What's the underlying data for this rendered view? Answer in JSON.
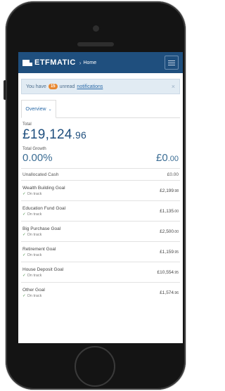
{
  "app": {
    "brand": "ETFMATIC",
    "crumb": "Home",
    "crumb_sep": "›"
  },
  "alert": {
    "prefix": "You have",
    "count": "15",
    "middle": "unread",
    "link": "notifications",
    "close": "×"
  },
  "tabs": {
    "overview": "Overview",
    "chevron": "⌄"
  },
  "summary": {
    "total_label": "Total",
    "total_main": "£19,124",
    "total_pence": ".96",
    "growth_label": "Total Growth",
    "growth_pct": "0.00%",
    "growth_main": "£0",
    "growth_pence": ".00"
  },
  "cash": {
    "label": "Unallocated Cash",
    "value": "£0.00"
  },
  "goals": [
    {
      "name": "Wealth Building Goal",
      "status": "On track",
      "main": "£2,199",
      "pence": ".98"
    },
    {
      "name": "Education Fund Goal",
      "status": "On track",
      "main": "£1,135",
      "pence": ".00"
    },
    {
      "name": "Big Purchase Goal",
      "status": "On track",
      "main": "£2,500",
      "pence": ".00"
    },
    {
      "name": "Retirement Goal",
      "status": "On track",
      "main": "£1,159",
      "pence": ".95"
    },
    {
      "name": "House Deposit Goal",
      "status": "On track",
      "main": "£10,554",
      "pence": ".95"
    },
    {
      "name": "Other Goal",
      "status": "On track",
      "main": "£1,574",
      "pence": ".96"
    }
  ],
  "icons": {
    "check": "check-icon",
    "menu": "menu-icon",
    "close": "close-icon",
    "logo": "logo-icon"
  },
  "colors": {
    "brand": "#1f4f7e",
    "badge": "#e8872f",
    "alert_bg": "#e1ebf3",
    "link": "#2a6aa8"
  }
}
